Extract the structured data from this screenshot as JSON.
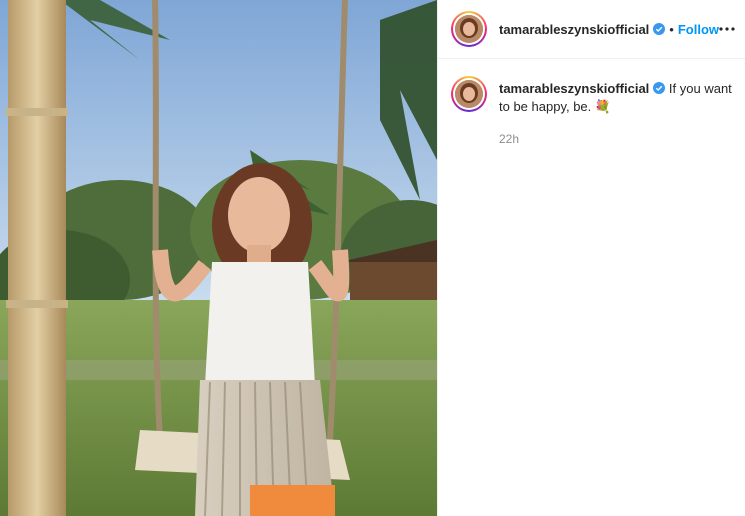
{
  "post": {
    "username": "tamarableszynskiofficial",
    "follow_label": "Follow",
    "separator": "•",
    "caption": "If you want to be happy, be.",
    "caption_emoji": "💐",
    "timestamp": "22h"
  },
  "colors": {
    "follow": "#0095f6",
    "verified": "#3897f0",
    "muted": "#8e8e8e"
  },
  "icons": {
    "verified": "verified-badge-icon",
    "more": "more-options-icon"
  }
}
